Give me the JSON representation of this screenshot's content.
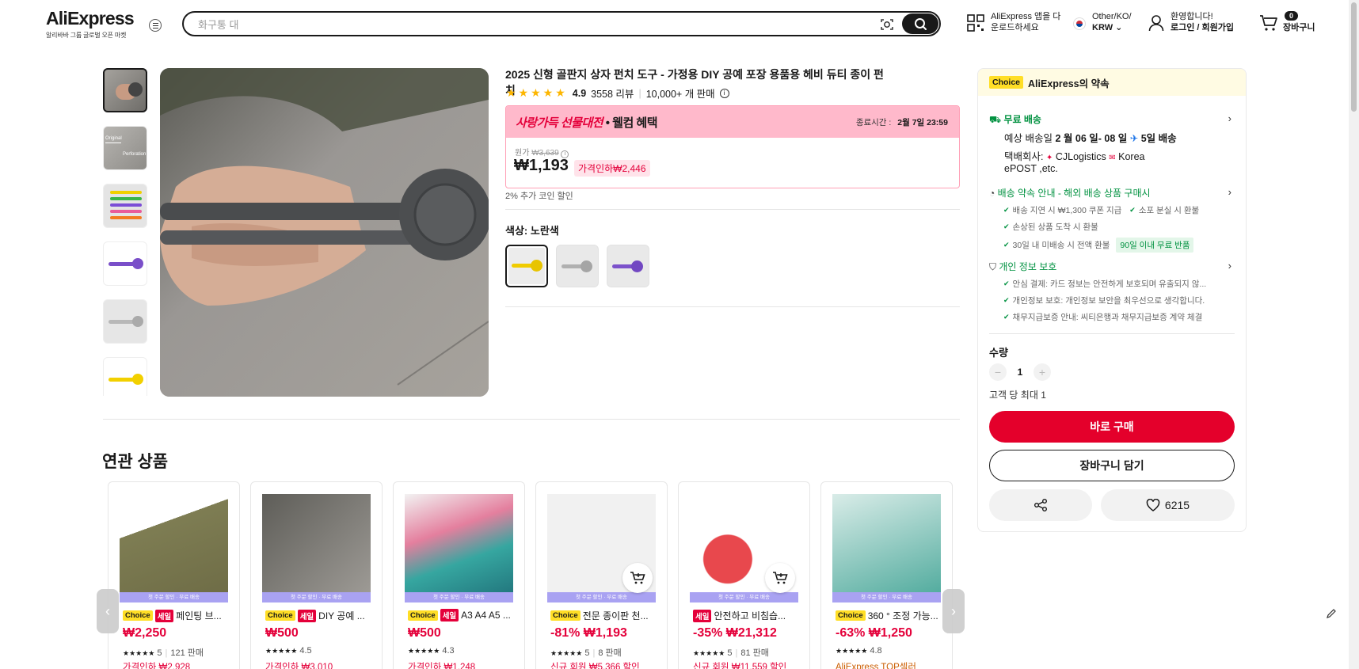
{
  "header": {
    "logo": "AliExpress",
    "logo_sub": "알리바바 그룹 글로벌 오픈 마켓",
    "search_placeholder": "화구통 대",
    "app_line1": "AliExpress 앱을 다",
    "app_line2": "운로드하세요",
    "region_line1": "Other/KO/",
    "region_line2": "KRW",
    "account_line1": "환영합니다!",
    "account_line2": "로그인 / 회원가입",
    "cart_count": "0",
    "cart_label": "장바구니"
  },
  "product": {
    "title": "2025 신형 골판지 상자 펀치 도구 - 가정용 DIY 공예 포장 용품용 헤비 듀티 종이 펀치",
    "rating": "4.9",
    "reviews": "3558 리뷰",
    "sold": "10,000+ 개 판매",
    "promo_brand": "사랑가득 선물대전",
    "promo_suffix": "• 웰컴 혜택",
    "promo_end_label": "종료시간 :",
    "promo_end_time": "2월 7일 23:59",
    "orig_label": "원가",
    "orig_price": "₩3,639",
    "price": "₩1,193",
    "discount": "가격인하₩2,446",
    "coin": "2% 추가 코인 할인",
    "color_label": "색상: 노란색",
    "thumbs": [
      "gray",
      "label",
      "multi",
      "purple",
      "gray2",
      "yellow"
    ],
    "swatches": [
      "yellow",
      "gray",
      "purple"
    ],
    "selected_swatch": "yellow"
  },
  "related": {
    "title": "연관 상품",
    "strip": "첫 주문 할인 · 무료 배송",
    "items": [
      {
        "badges": [
          "Choice",
          "세일"
        ],
        "name": "페인팅 브...",
        "price": "₩2,250",
        "stars": "★★★★★",
        "rating": "5",
        "sold": "121 판매",
        "extra": "가격인하 ₩2,928",
        "has_cart": false
      },
      {
        "badges": [
          "Choice",
          "세일"
        ],
        "name": "DIY 공예 ...",
        "price": "₩500",
        "stars": "★★★★★",
        "rating": "4.5",
        "sold": "",
        "extra": "가격인하 ₩3,010",
        "has_cart": false
      },
      {
        "badges": [
          "Choice",
          "세일"
        ],
        "name": "A3 A4 A5 ...",
        "price": "₩500",
        "stars": "★★★★★",
        "rating": "4.3",
        "sold": "",
        "extra": "가격인하 ₩1,248",
        "has_cart": false
      },
      {
        "badges": [
          "Choice"
        ],
        "name": "전문 종이판 천...",
        "price": "-81% ₩1,193",
        "stars": "★★★★★",
        "rating": "5",
        "sold": "8 판매",
        "extra": "신규 회원 ₩5,366 할인",
        "has_cart": true
      },
      {
        "badges": [
          "세일"
        ],
        "name": "안전하고 비침습...",
        "price": "-35% ₩21,312",
        "stars": "★★★★★",
        "rating": "5",
        "sold": "81 판매",
        "extra": "신규 회원 ₩11,559 할인",
        "has_cart": true
      },
      {
        "badges": [
          "Choice"
        ],
        "name": "360 ° 조정 가능...",
        "price": "-63% ₩1,250",
        "stars": "★★★★★",
        "rating": "4.8",
        "sold": "",
        "extra": "AliExpress TOP셀러",
        "has_cart": false
      }
    ]
  },
  "panel": {
    "choice_badge": "Choice",
    "choice_title": "AliExpress의 약속",
    "shipping_title": "무료 배송",
    "delivery_prefix": "예상 배송일",
    "delivery_dates": "2 월 06 일- 08 일",
    "delivery_days": "5일 배송",
    "carrier_label": "택배회사:",
    "carrier1": "CJLogistics",
    "carrier2": "Korea",
    "carrier3": "ePOST ,etc.",
    "promise_title": "배송 약속 안내 - 해외 배송 상품 구매시",
    "promise_1": "배송 지연 시 ₩1,300 쿠폰 지급",
    "promise_2": "소포 분실 시 환불",
    "promise_3": "손상된 상품 도착 시 환불",
    "promise_4": "30일 내 미배송 시 전액 환불",
    "promise_tag": "90일 이내 무료 반품",
    "privacy_title": "개인 정보 보호",
    "privacy_1": "안심 결제: 카드 정보는 안전하게 보호되며 유출되지 않...",
    "privacy_2": "개인정보 보호: 개인정보 보안을 최우선으로 생각합니다.",
    "privacy_3": "채무지급보증 안내: 씨티은행과 채무지급보증 계약 체결",
    "qty_label": "수량",
    "qty": "1",
    "max_note": "고객 당 최대 1",
    "buy_label": "바로 구매",
    "cart_label": "장바구니 담기",
    "wish_count": "6215"
  }
}
